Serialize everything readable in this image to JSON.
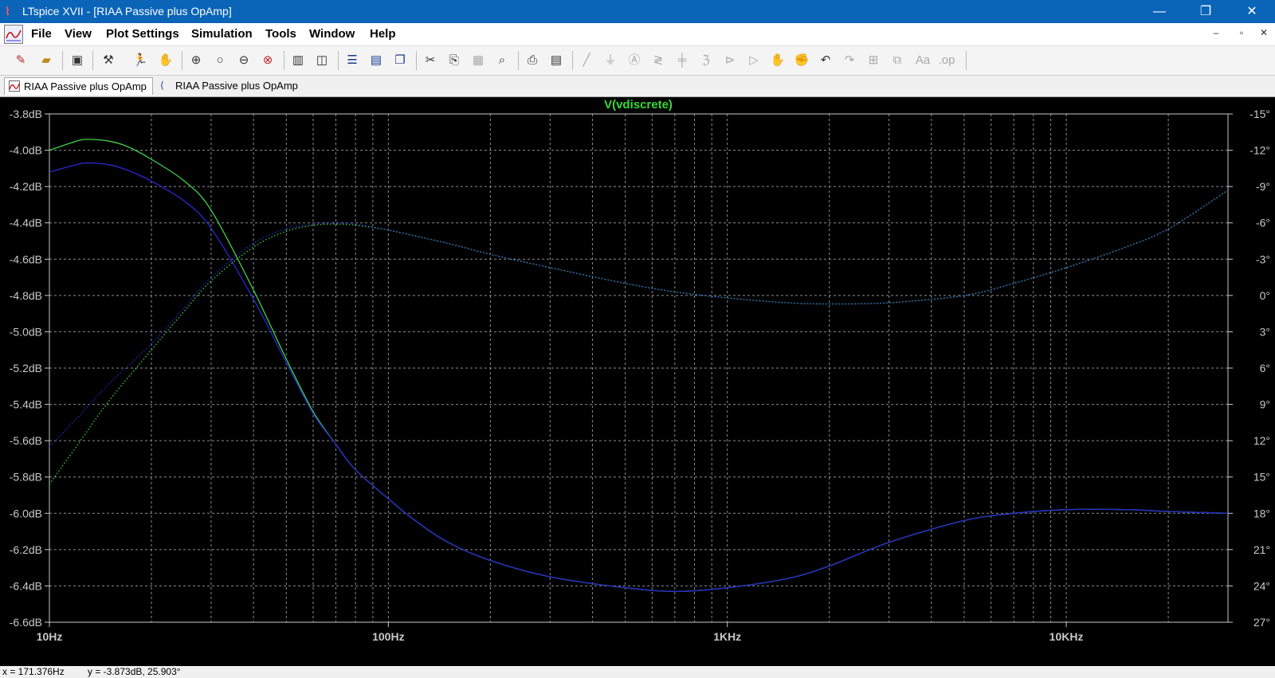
{
  "window": {
    "title": "LTspice XVII - [RIAA Passive plus OpAmp]",
    "app_icon": "ltspice-logo-icon",
    "controls": {
      "minimize": "—",
      "maximize": "❐",
      "close": "✕"
    }
  },
  "menu": {
    "items": [
      "File",
      "View",
      "Plot Settings",
      "Simulation",
      "Tools",
      "Window",
      "Help"
    ],
    "mdi_controls": {
      "minimize": "–",
      "restore": "▫",
      "close": "✕"
    }
  },
  "toolbar": {
    "icons": [
      "new-schematic-icon",
      "open-icon",
      "save-icon",
      "control-panel-icon",
      "run-icon",
      "halt-icon",
      "zoom-in-icon",
      "zoom-box-icon",
      "zoom-out-icon",
      "zoom-cancel-icon",
      "autorange-icon",
      "manual-limits-icon",
      "tile-horizontal-icon",
      "tile-vertical-icon",
      "cascade-icon",
      "cut-icon",
      "copy-icon",
      "paste-icon",
      "find-icon",
      "print-icon",
      "print-setup-icon",
      "draw-wire-icon",
      "ground-icon",
      "label-net-icon",
      "resistor-icon",
      "capacitor-icon",
      "inductor-icon",
      "diode-icon",
      "component-icon",
      "move-icon",
      "drag-icon",
      "undo-icon",
      "redo-icon",
      "rotate-icon",
      "mirror-icon",
      "text-icon",
      "spice-directive-icon"
    ]
  },
  "tabs": [
    {
      "label": "RIAA Passive plus OpAmp",
      "icon": "waveform-icon",
      "active": true
    },
    {
      "label": "RIAA Passive plus OpAmp",
      "icon": "schematic-icon",
      "active": false
    }
  ],
  "chart_data": {
    "type": "line",
    "title": "V(vdiscrete)",
    "xscale": "log",
    "xlim": [
      10,
      30000
    ],
    "xticks": [
      {
        "value": 10,
        "label": "10Hz"
      },
      {
        "value": 100,
        "label": "100Hz"
      },
      {
        "value": 1000,
        "label": "1KHz"
      },
      {
        "value": 10000,
        "label": "10KHz"
      }
    ],
    "yleft": {
      "ylim": [
        -6.6,
        -3.8
      ],
      "ticks": [
        "-3.8dB",
        "-4.0dB",
        "-4.2dB",
        "-4.4dB",
        "-4.6dB",
        "-4.8dB",
        "-5.0dB",
        "-5.2dB",
        "-5.4dB",
        "-5.6dB",
        "-5.8dB",
        "-6.0dB",
        "-6.2dB",
        "-6.4dB",
        "-6.6dB"
      ],
      "tick_values": [
        -3.8,
        -4.0,
        -4.2,
        -4.4,
        -4.6,
        -4.8,
        -5.0,
        -5.2,
        -5.4,
        -5.6,
        -5.8,
        -6.0,
        -6.2,
        -6.4,
        -6.6
      ]
    },
    "yright": {
      "ylim": [
        -15,
        27
      ],
      "ticks": [
        "27°",
        "24°",
        "21°",
        "18°",
        "15°",
        "12°",
        "9°",
        "6°",
        "3°",
        "0°",
        "-3°",
        "-6°",
        "-9°",
        "-12°",
        "-15°"
      ],
      "tick_values": [
        27,
        24,
        21,
        18,
        15,
        12,
        9,
        6,
        3,
        0,
        -3,
        -6,
        -9,
        -12,
        -15
      ]
    },
    "grid": true,
    "colors": {
      "background": "#000000",
      "grid": "#8c8c8c",
      "axis": "#c8c8c8",
      "title": "#32dc32",
      "series_green": "#3fd24a",
      "series_blue": "#2828d2"
    },
    "series": [
      {
        "axis": "left",
        "style": "solid",
        "color": "#3fd24a",
        "x": [
          10,
          12,
          13,
          15,
          17,
          20,
          25,
          30,
          40,
          50,
          60,
          70,
          80,
          100,
          120,
          150,
          200,
          300,
          500,
          700,
          1000,
          1500,
          2000,
          3000,
          5000,
          7000,
          10000,
          15000,
          20000,
          30000
        ],
        "y": [
          -4.0,
          -3.95,
          -3.94,
          -3.95,
          -3.98,
          -4.05,
          -4.17,
          -4.33,
          -4.77,
          -5.15,
          -5.44,
          -5.62,
          -5.76,
          -5.92,
          -6.04,
          -6.16,
          -6.26,
          -6.35,
          -6.41,
          -6.43,
          -6.41,
          -6.36,
          -6.29,
          -6.16,
          -6.04,
          -6.0,
          -5.98,
          -5.98,
          -5.99,
          -6.0
        ]
      },
      {
        "axis": "left",
        "style": "solid",
        "color": "#2828d2",
        "x": [
          10,
          12,
          13,
          15,
          17,
          20,
          25,
          30,
          40,
          50,
          60,
          70,
          80,
          100,
          120,
          150,
          200,
          300,
          500,
          700,
          1000,
          1500,
          2000,
          3000,
          5000,
          7000,
          10000,
          15000,
          20000,
          30000
        ],
        "y": [
          -4.12,
          -4.08,
          -4.07,
          -4.08,
          -4.11,
          -4.17,
          -4.28,
          -4.43,
          -4.82,
          -5.17,
          -5.45,
          -5.62,
          -5.76,
          -5.92,
          -6.04,
          -6.16,
          -6.26,
          -6.35,
          -6.41,
          -6.43,
          -6.41,
          -6.36,
          -6.29,
          -6.16,
          -6.04,
          -6.0,
          -5.98,
          -5.98,
          -5.99,
          -6.0
        ]
      },
      {
        "axis": "right",
        "style": "dotted",
        "color": "#3fd24a",
        "x": [
          10,
          12,
          15,
          20,
          25,
          30,
          40,
          50,
          60,
          70,
          80,
          100,
          150,
          200,
          300,
          500,
          700,
          1000,
          1500,
          2000,
          3000,
          5000,
          7000,
          10000,
          15000,
          20000,
          30000
        ],
        "y": [
          15.6,
          12.5,
          8.7,
          4.5,
          1.3,
          -1.2,
          -4.0,
          -5.3,
          -5.8,
          -5.9,
          -5.8,
          -5.4,
          -4.3,
          -3.4,
          -2.3,
          -1.0,
          -0.3,
          0.2,
          0.6,
          0.7,
          0.6,
          0.0,
          -1.0,
          -2.3,
          -4.0,
          -5.5,
          -8.7
        ]
      },
      {
        "axis": "right",
        "style": "dotted",
        "color": "#2828d2",
        "x": [
          10,
          12,
          15,
          20,
          25,
          30,
          40,
          50,
          60,
          70,
          80,
          100,
          150,
          200,
          300,
          500,
          700,
          1000,
          1500,
          2000,
          3000,
          5000,
          7000,
          10000,
          15000,
          20000,
          30000
        ],
        "y": [
          12.5,
          10.2,
          7.3,
          4.0,
          1.0,
          -1.5,
          -4.3,
          -5.5,
          -5.9,
          -6.0,
          -5.9,
          -5.4,
          -4.3,
          -3.4,
          -2.3,
          -1.0,
          -0.3,
          0.2,
          0.6,
          0.7,
          0.6,
          0.0,
          -1.0,
          -2.3,
          -4.0,
          -5.5,
          -8.7
        ]
      }
    ]
  },
  "status": {
    "x_readout": "x = 171.376Hz",
    "y_readout": "y = -3.873dB, 25.903°"
  }
}
